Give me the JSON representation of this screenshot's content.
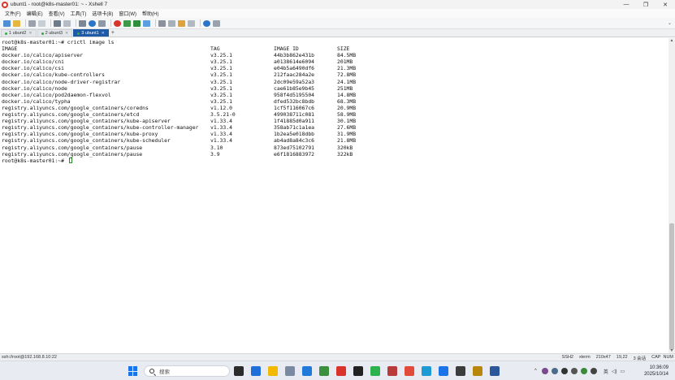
{
  "window": {
    "title": "ubunt1 - root@k8s-master01: ~ - Xshell 7",
    "controls": [
      "—",
      "❐",
      "✕"
    ]
  },
  "menu": [
    "文件(F)",
    "编辑(E)",
    "查看(V)",
    "工具(T)",
    "选项卡(B)",
    "窗口(W)",
    "帮助(H)"
  ],
  "tabs": [
    {
      "label": "1 ubunt2"
    },
    {
      "label": "2 ubunt3"
    },
    {
      "label": "3 ubunt1"
    }
  ],
  "terminal": {
    "command_line": "root@k8s-master01:~# crictl image ls",
    "headers": [
      "IMAGE",
      "TAG",
      "IMAGE ID",
      "SIZE"
    ],
    "rows": [
      [
        "docker.io/calico/apiserver",
        "v3.25.1",
        "44b3b862e431b",
        "84.5MB"
      ],
      [
        "docker.io/calico/cni",
        "v3.25.1",
        "a0138614e6094",
        "201MB"
      ],
      [
        "docker.io/calico/csi",
        "v3.25.1",
        "e04b5a6490df6",
        "21.3MB"
      ],
      [
        "docker.io/calico/kube-controllers",
        "v3.25.1",
        "212faac284a2e",
        "72.8MB"
      ],
      [
        "docker.io/calico/node-driver-registrar",
        "v3.25.1",
        "2dc09e59a52a3",
        "24.1MB"
      ],
      [
        "docker.io/calico/node",
        "v3.25.1",
        "cae61b85e9b45",
        "251MB"
      ],
      [
        "docker.io/calico/pod2daemon-flexvol",
        "v3.25.1",
        "958f4d5195504",
        "14.8MB"
      ],
      [
        "docker.io/calico/typha",
        "v3.25.1",
        "dfed532bc8bdb",
        "68.3MB"
      ],
      [
        "registry.aliyuncs.com/google_containers/coredns",
        "v1.12.0",
        "1cf5f116067c6",
        "20.9MB"
      ],
      [
        "registry.aliyuncs.com/google_containers/etcd",
        "3.5.21-0",
        "499038711c081",
        "58.9MB"
      ],
      [
        "registry.aliyuncs.com/google_containers/kube-apiserver",
        "v1.33.4",
        "1f41885d0a911",
        "30.1MB"
      ],
      [
        "registry.aliyuncs.com/google_containers/kube-controller-manager",
        "v1.33.4",
        "358ab71c1a1ea",
        "27.6MB"
      ],
      [
        "registry.aliyuncs.com/google_containers/kube-proxy",
        "v1.33.4",
        "1b2ea5e018dbb",
        "31.9MB"
      ],
      [
        "registry.aliyuncs.com/google_containers/kube-scheduler",
        "v1.33.4",
        "ab4ad8a84c3c6",
        "21.8MB"
      ],
      [
        "registry.aliyuncs.com/google_containers/pause",
        "3.10",
        "873ed75102791",
        "320kB"
      ],
      [
        "registry.aliyuncs.com/google_containers/pause",
        "3.9",
        "e6f1816883972",
        "322kB"
      ]
    ],
    "prompt": "root@k8s-master01:~# "
  },
  "statusbar": {
    "connection": "ssh://root@192.168.8.10:22",
    "protocol": "SSH2",
    "term": "xterm",
    "size": "210x47",
    "cursor_pos": "19,22",
    "sessions": "3 会话",
    "caps": "CAP",
    "num": "NUM"
  },
  "taskbar": {
    "search_placeholder": "搜索",
    "time": "10:36:09",
    "date": "2025/10/14",
    "ime": "英",
    "icon_colors": [
      "#2b2b2b",
      "#1e6fd9",
      "#f2b900",
      "#7a8aa0",
      "#1f7ad9",
      "#3c8f3c",
      "#d9342b",
      "#222",
      "#2bb24c",
      "#b93a3a",
      "#e24b3b",
      "#1b9ad6",
      "#1a73e8",
      "#3c3c3c",
      "#b8860b",
      "#2b579a"
    ]
  }
}
